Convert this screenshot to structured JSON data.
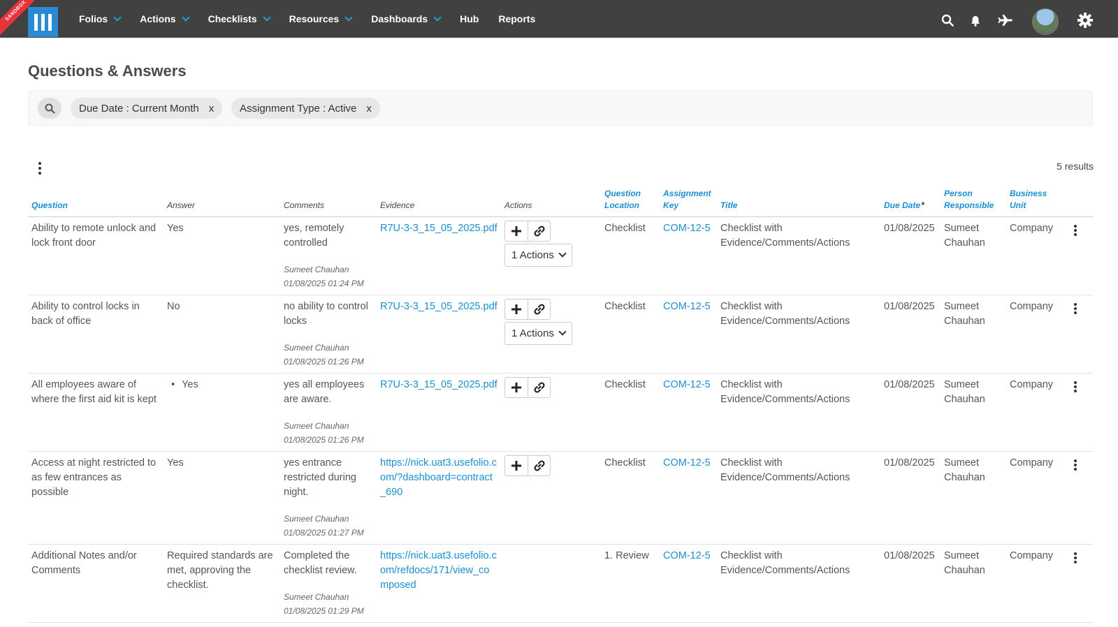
{
  "brand": {
    "sandbox_label": "SANDBOX"
  },
  "nav": {
    "items": [
      {
        "label": "Folios",
        "has_menu": true
      },
      {
        "label": "Actions",
        "has_menu": true
      },
      {
        "label": "Checklists",
        "has_menu": true
      },
      {
        "label": "Resources",
        "has_menu": true
      },
      {
        "label": "Dashboards",
        "has_menu": true
      },
      {
        "label": "Hub",
        "has_menu": false
      },
      {
        "label": "Reports",
        "has_menu": false
      }
    ],
    "icons": [
      "search-icon",
      "bell-icon",
      "plane-icon",
      "avatar",
      "gear-icon"
    ]
  },
  "page": {
    "title": "Questions & Answers"
  },
  "filters": {
    "chips": [
      {
        "label": "Due Date : Current Month",
        "remove": "x"
      },
      {
        "label": "Assignment Type : Active",
        "remove": "x"
      }
    ]
  },
  "results": {
    "count_label": "5 results"
  },
  "table": {
    "columns": [
      {
        "key": "question",
        "label": "Question",
        "sortable": true
      },
      {
        "key": "answer",
        "label": "Answer",
        "sortable": false
      },
      {
        "key": "comments",
        "label": "Comments",
        "sortable": false
      },
      {
        "key": "evidence",
        "label": "Evidence",
        "sortable": false
      },
      {
        "key": "actions",
        "label": "Actions",
        "sortable": false
      },
      {
        "key": "question_location",
        "label": "Question Location",
        "sortable": true
      },
      {
        "key": "assignment_key",
        "label": "Assignment Key",
        "sortable": true
      },
      {
        "key": "title",
        "label": "Title",
        "sortable": true
      },
      {
        "key": "due_date",
        "label": "Due Date",
        "sortable": true,
        "sort_indicator": "▲"
      },
      {
        "key": "person_responsible",
        "label": "Person Responsible",
        "sortable": true
      },
      {
        "key": "business_unit",
        "label": "Business Unit",
        "sortable": true
      }
    ],
    "rows": [
      {
        "question": "Ability to remote unlock and lock front door",
        "answer": "Yes",
        "answer_bullet": false,
        "comment": "yes, remotely controlled",
        "comment_by": "Sumeet Chauhan",
        "comment_date": "01/08/2025 01:24 PM",
        "evidence": "R7U-3-3_15_05_2025.pdf",
        "actions_dropdown": "1 Actions",
        "location": "Checklist",
        "assignment_key": "COM-12-5",
        "title": "Checklist with Evidence/Comments/Actions",
        "due_date": "01/08/2025",
        "person": "Sumeet Chauhan",
        "business_unit": "Company"
      },
      {
        "question": "Ability to control locks in back of office",
        "answer": "No",
        "answer_bullet": false,
        "comment": "no ability to control locks",
        "comment_by": "Sumeet Chauhan",
        "comment_date": "01/08/2025 01:26 PM",
        "evidence": "R7U-3-3_15_05_2025.pdf",
        "actions_dropdown": "1 Actions",
        "location": "Checklist",
        "assignment_key": "COM-12-5",
        "title": "Checklist with Evidence/Comments/Actions",
        "due_date": "01/08/2025",
        "person": "Sumeet Chauhan",
        "business_unit": "Company"
      },
      {
        "question": "All employees aware of where the first aid kit is kept",
        "answer": "Yes",
        "answer_bullet": true,
        "comment": "yes all employees are aware.",
        "comment_by": "Sumeet Chauhan",
        "comment_date": "01/08/2025 01:26 PM",
        "evidence": "R7U-3-3_15_05_2025.pdf",
        "actions_dropdown": null,
        "location": "Checklist",
        "assignment_key": "COM-12-5",
        "title": "Checklist with Evidence/Comments/Actions",
        "due_date": "01/08/2025",
        "person": "Sumeet Chauhan",
        "business_unit": "Company"
      },
      {
        "question": "Access at night restricted to as few entrances as possible",
        "answer": "Yes",
        "answer_bullet": false,
        "comment": "yes entrance restricted during night.",
        "comment_by": "Sumeet Chauhan",
        "comment_date": "01/08/2025 01:27 PM",
        "evidence": "https://nick.uat3.usefolio.com/?dashboard=contract_690",
        "actions_dropdown": null,
        "location": "Checklist",
        "assignment_key": "COM-12-5",
        "title": "Checklist with Evidence/Comments/Actions",
        "due_date": "01/08/2025",
        "person": "Sumeet Chauhan",
        "business_unit": "Company"
      },
      {
        "question": "Additional Notes and/or Comments",
        "answer": "Required standards are met, approving the checklist.",
        "answer_bullet": false,
        "comment": "Completed the checklist review.",
        "comment_by": "Sumeet Chauhan",
        "comment_date": "01/08/2025 01:29 PM",
        "evidence": "https://nick.uat3.usefolio.com/refdocs/171/view_composed",
        "actions_dropdown": null,
        "no_action_buttons": true,
        "location": "1. Review",
        "assignment_key": "COM-12-5",
        "title": "Checklist with Evidence/Comments/Actions",
        "due_date": "01/08/2025",
        "person": "Sumeet Chauhan",
        "business_unit": "Company"
      }
    ]
  },
  "colors": {
    "nav_bg": "#414141",
    "accent": "#1a8fd0",
    "logo": "#2a8ad4",
    "sandbox": "#e8323c"
  }
}
